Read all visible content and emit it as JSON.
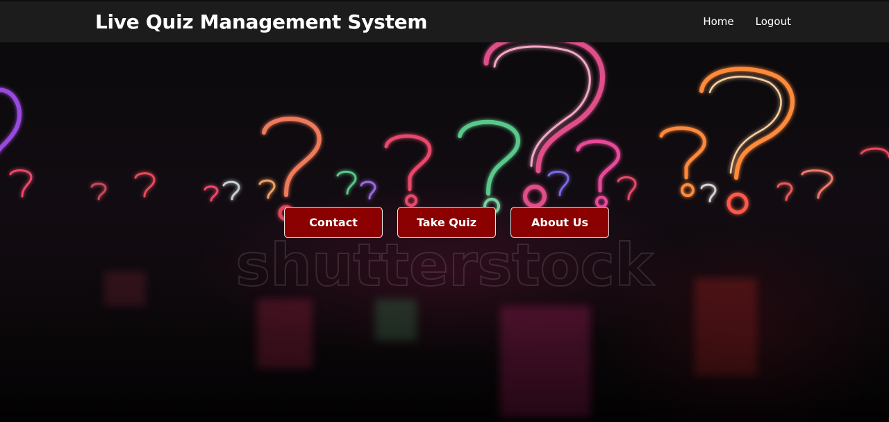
{
  "header": {
    "title": "Live Quiz Management System",
    "nav": [
      {
        "label": "Home"
      },
      {
        "label": "Logout"
      }
    ]
  },
  "hero": {
    "background": "neon question marks",
    "watermark": "shutterstock",
    "buttons": [
      {
        "label": "Contact"
      },
      {
        "label": "Take Quiz"
      },
      {
        "label": "About Us"
      }
    ]
  },
  "colors": {
    "navbar": "#1c1c1c",
    "button": "#8b0000",
    "text": "#ffffff"
  }
}
